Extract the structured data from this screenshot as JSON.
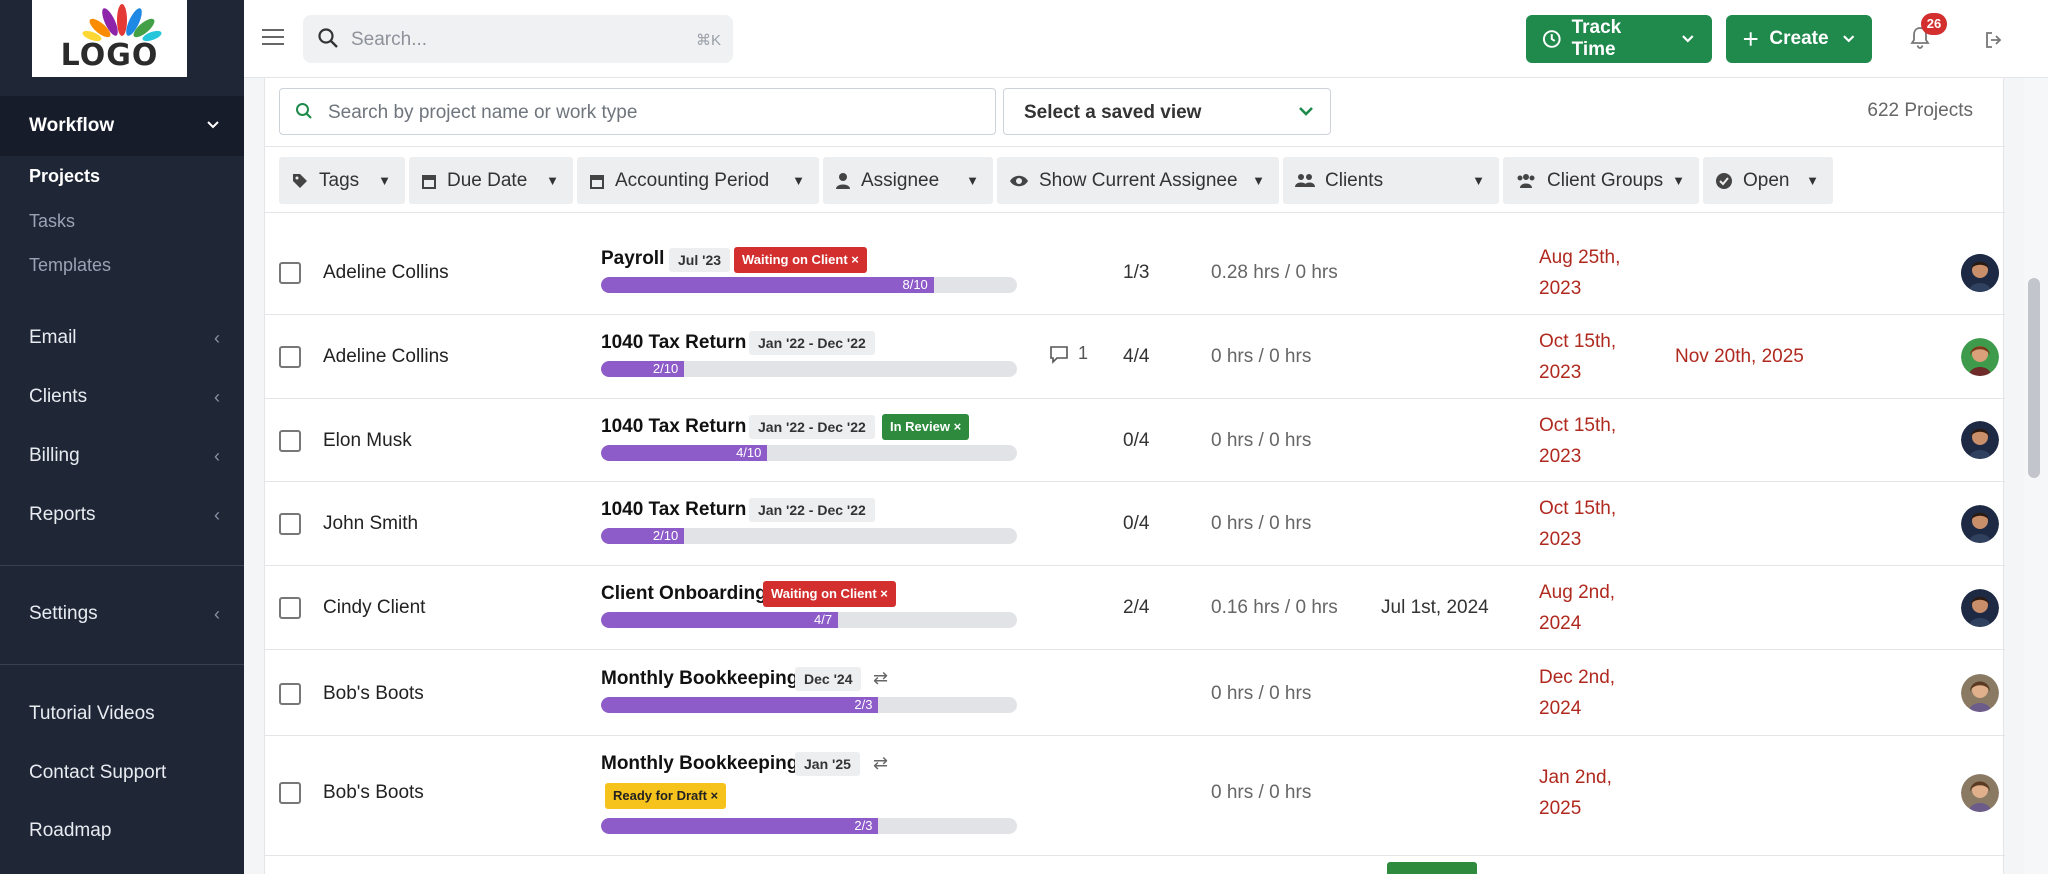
{
  "sidebar": {
    "logo_text": "LOGO",
    "items": [
      {
        "label": "Workflow",
        "icon": "workflow-icon"
      },
      {
        "label": "Email",
        "icon": "email-icon"
      },
      {
        "label": "Clients",
        "icon": "clients-icon"
      },
      {
        "label": "Billing",
        "icon": "billing-icon"
      },
      {
        "label": "Reports",
        "icon": "reports-icon"
      },
      {
        "label": "Settings",
        "icon": "settings-icon"
      },
      {
        "label": "Tutorial Videos",
        "icon": "video-icon"
      },
      {
        "label": "Contact Support",
        "icon": "support-icon"
      },
      {
        "label": "Roadmap",
        "icon": "roadmap-icon"
      }
    ],
    "subitems": [
      "Projects",
      "Tasks",
      "Templates"
    ]
  },
  "topbar": {
    "search_placeholder": "Search...",
    "search_shortcut": "⌘K",
    "track_time_label": "Track Time",
    "create_label": "Create",
    "notification_count": "26"
  },
  "toolbar": {
    "project_search_placeholder": "Search by project name or work type",
    "saved_view_label": "Select a saved view",
    "project_count": "622 Projects"
  },
  "filters": [
    {
      "label": "Tags"
    },
    {
      "label": "Due Date"
    },
    {
      "label": "Accounting Period"
    },
    {
      "label": "Assignee"
    },
    {
      "label": "Show Current Assignee"
    },
    {
      "label": "Clients"
    },
    {
      "label": "Client Groups"
    },
    {
      "label": "Open"
    }
  ],
  "rows": [
    {
      "client": "Adeline Collins",
      "project": "Payroll",
      "period": "Jul '23",
      "status": "Waiting on Client ×",
      "progress_label": "8/10",
      "progress": 0.8,
      "comments": "",
      "tasks": "1/3",
      "hours": "0.28 hrs / 0 hrs",
      "start": "",
      "due_line1": "Aug 25th,",
      "due_line2": "2023",
      "due2": ""
    },
    {
      "client": "Adeline Collins",
      "project": "1040 Tax Return",
      "period": "Jan '22 - Dec '22",
      "status": "",
      "progress_label": "2/10",
      "progress": 0.2,
      "comments": "1",
      "tasks": "4/4",
      "hours": "0 hrs / 0 hrs",
      "start": "",
      "due_line1": "Oct 15th,",
      "due_line2": "2023",
      "due2": "Nov 20th, 2025"
    },
    {
      "client": "Elon Musk",
      "project": "1040 Tax Return",
      "period": "Jan '22 - Dec '22",
      "status": "In Review ×",
      "progress_label": "4/10",
      "progress": 0.4,
      "comments": "",
      "tasks": "0/4",
      "hours": "0 hrs / 0 hrs",
      "start": "",
      "due_line1": "Oct 15th,",
      "due_line2": "2023",
      "due2": ""
    },
    {
      "client": "John Smith",
      "project": "1040 Tax Return",
      "period": "Jan '22 - Dec '22",
      "status": "",
      "progress_label": "2/10",
      "progress": 0.2,
      "comments": "",
      "tasks": "0/4",
      "hours": "0 hrs / 0 hrs",
      "start": "",
      "due_line1": "Oct 15th,",
      "due_line2": "2023",
      "due2": ""
    },
    {
      "client": "Cindy Client",
      "project": "Client Onboarding",
      "period": "",
      "status": "Waiting on Client ×",
      "progress_label": "4/7",
      "progress": 0.571,
      "comments": "",
      "tasks": "2/4",
      "hours": "0.16 hrs / 0 hrs",
      "start": "Jul 1st, 2024",
      "due_line1": "Aug 2nd,",
      "due_line2": "2024",
      "due2": ""
    },
    {
      "client": "Bob's Boots",
      "project": "Monthly Bookkeeping",
      "period": "Dec '24",
      "status": "",
      "progress_label": "2/3",
      "progress": 0.667,
      "comments": "",
      "tasks": "",
      "hours": "0 hrs / 0 hrs",
      "start": "",
      "due_line1": "Dec 2nd,",
      "due_line2": "2024",
      "due2": ""
    },
    {
      "client": "Bob's Boots",
      "project": "Monthly Bookkeeping",
      "period": "Jan '25",
      "status": "Ready for Draft ×",
      "progress_label": "2/3",
      "progress": 0.667,
      "comments": "",
      "tasks": "",
      "hours": "0 hrs / 0 hrs",
      "start": "",
      "due_line1": "Jan 2nd,",
      "due_line2": "2025",
      "due2": ""
    }
  ],
  "colors": {
    "sidebar_bg": "#1f2636",
    "brand_green": "#1f8a4c",
    "progress_purple": "#8e5cc8",
    "overdue_red": "#b0291e",
    "status_red": "#d32f2f",
    "status_green": "#2e8b3e",
    "status_yellow": "#f6c21c"
  }
}
